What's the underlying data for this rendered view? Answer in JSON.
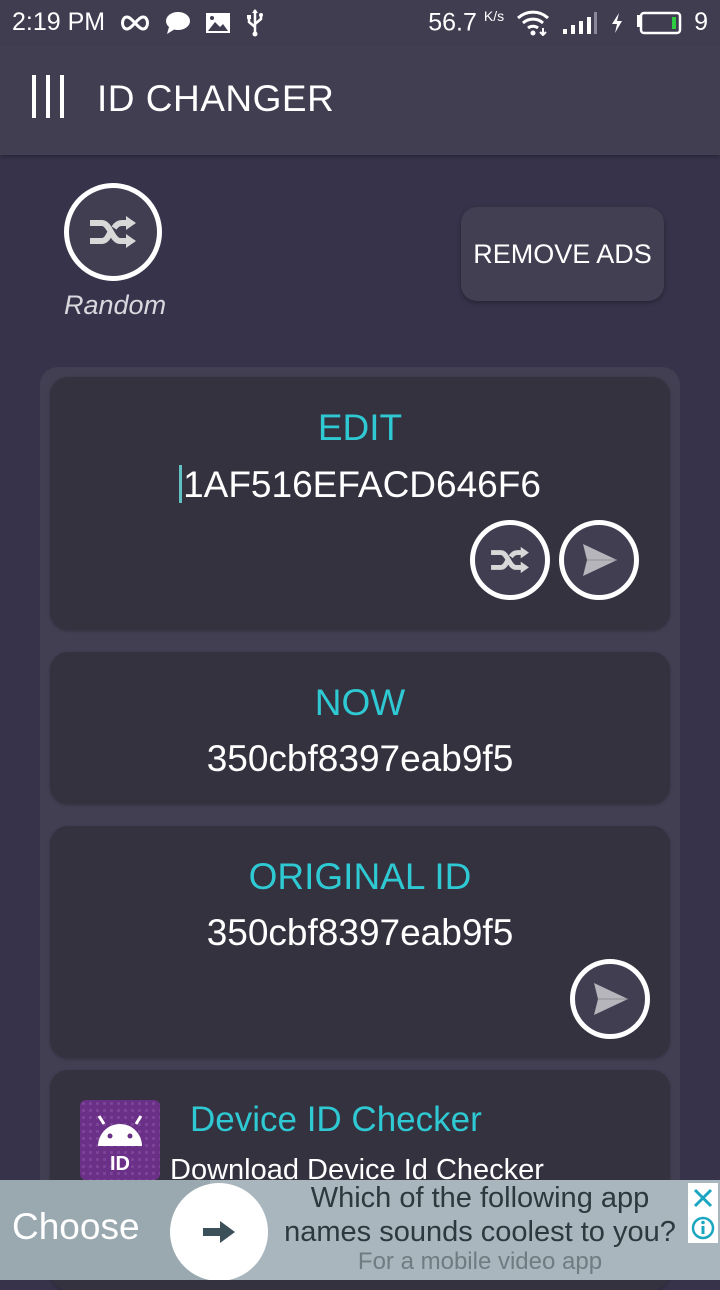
{
  "status_bar": {
    "time": "2:19 PM",
    "left_icons": [
      "infinity-icon",
      "chat-bubble-icon",
      "image-icon",
      "usb-icon"
    ],
    "net_speed": "56.7",
    "net_speed_unit": "K/s",
    "right_icons": [
      "wifi-icon",
      "signal-icon",
      "charging-icon",
      "battery-icon"
    ],
    "battery_level": "9",
    "battery_color": "#2ecc40"
  },
  "app_bar": {
    "title": "ID CHANGER",
    "menu_icon": "menu-icon"
  },
  "top_actions": {
    "random_label": "Random",
    "random_icon": "shuffle-icon",
    "remove_ads_label": "REMOVE ADS"
  },
  "cards": {
    "edit": {
      "label": "EDIT",
      "value": "1AF516EFACD646F6",
      "buttons": [
        "shuffle-icon",
        "send-icon"
      ]
    },
    "now": {
      "label": "NOW",
      "value": "350cbf8397eab9f5"
    },
    "original": {
      "label": "ORIGINAL ID",
      "value": "350cbf8397eab9f5",
      "buttons": [
        "send-icon"
      ]
    },
    "promo": {
      "icon_text": "ID",
      "title": "Device ID Checker",
      "subtitle": "Download Device Id Checker"
    }
  },
  "ad": {
    "choose_label": "Choose",
    "line1": "Which of the following app",
    "line2": "names sounds coolest to you?",
    "line3": "For a mobile video app",
    "close_icon": "close-icon",
    "info_icon": "info-icon"
  },
  "colors": {
    "accent": "#2ec9d3",
    "background": "#36334a",
    "app_bar": "#413e51",
    "card": "#35323f",
    "container": "#423f53",
    "ad_background": "#a9b6bd"
  }
}
